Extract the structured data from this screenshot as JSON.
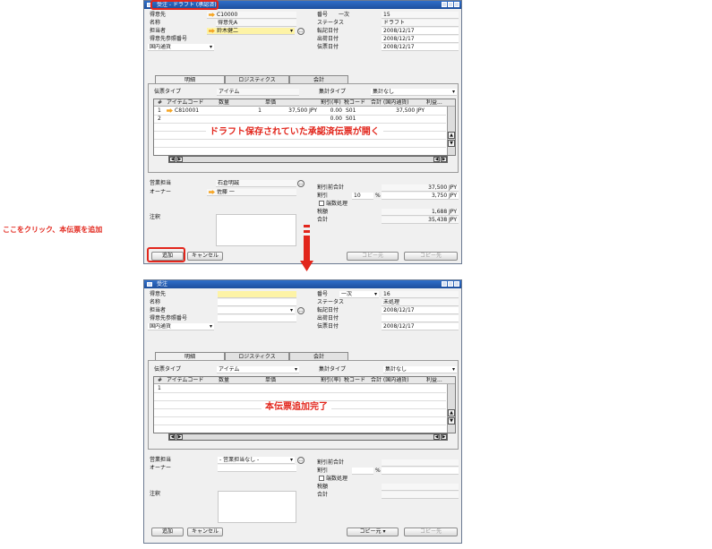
{
  "window1": {
    "title": "受注 - ドラフト (承認済)",
    "header": {
      "customer_label": "得意先",
      "customer_value": "C10000",
      "name_label": "名称",
      "name_value": "得意先A",
      "contact_label": "担当者",
      "contact_value": "鈴木健二",
      "ref_label": "得意先参照番号",
      "currency": "国内通貨",
      "no_label": "番号",
      "no_series": "一次",
      "no_value": "15",
      "status_label": "ステータス",
      "status_value": "ドラフト",
      "posting_label": "転記日付",
      "posting_value": "2008/12/17",
      "delivery_label": "出荷日付",
      "delivery_value": "2008/12/17",
      "doc_date_label": "伝票日付",
      "doc_date_value": "2008/12/17"
    },
    "tabs": [
      "明細",
      "ロジスティクス",
      "会計"
    ],
    "item_type_label": "伝票タイプ",
    "item_type_value": "アイテム",
    "summary_type_label": "集計タイプ",
    "summary_type_value": "集計なし",
    "grid_headers": [
      "#",
      "アイテムコード",
      "数量",
      "単価",
      "割引(率)",
      "税コード",
      "合計 (国内通貨)",
      "利益..."
    ],
    "rows": [
      {
        "no": "1",
        "code": "C810001",
        "qty": "1",
        "price": "37,500 JPY",
        "disc": "0.00",
        "tax": "S01",
        "total": "37,500 JPY"
      },
      {
        "no": "2",
        "code": "",
        "qty": "",
        "price": "",
        "disc": "0.00",
        "tax": "S01",
        "total": ""
      }
    ],
    "footer": {
      "sales_emp_label": "営業担当",
      "sales_emp_value": "石倉明誠",
      "owner_label": "オーナー",
      "owner_value": "佐藤 一",
      "remarks_label": "注釈",
      "before_disc_label": "割引前合計",
      "before_disc_value": "37,500 JPY",
      "disc_label": "割引",
      "disc_pct": "10",
      "disc_pct_sign": "%",
      "disc_value": "3,750 JPY",
      "rounding_label": "端数処理",
      "tax_label": "税額",
      "tax_value": "1,688 JPY",
      "total_label": "合計",
      "total_value": "35,438 JPY"
    },
    "buttons": {
      "add": "追加",
      "cancel": "キャンセル",
      "copy_from": "コピー元",
      "copy_to": "コピー先"
    },
    "annotation": "ドラフト保存されていた承認済伝票が開く"
  },
  "side_annotation": "ここをクリック、本伝票を追加",
  "window2": {
    "title": "受注",
    "header": {
      "customer_label": "得意先",
      "name_label": "名称",
      "contact_label": "担当者",
      "ref_label": "得意先参照番号",
      "currency": "国内通貨",
      "no_label": "番号",
      "no_series": "一次",
      "no_value": "16",
      "status_label": "ステータス",
      "status_value": "未処理",
      "posting_label": "転記日付",
      "posting_value": "2008/12/17",
      "delivery_label": "出荷日付",
      "delivery_value": "",
      "doc_date_label": "伝票日付",
      "doc_date_value": "2008/12/17"
    },
    "tabs": [
      "明細",
      "ロジスティクス",
      "会計"
    ],
    "item_type_label": "伝票タイプ",
    "item_type_value": "アイテム",
    "summary_type_label": "集計タイプ",
    "summary_type_value": "集計なし",
    "grid_headers": [
      "#",
      "アイテムコード",
      "数量",
      "単価",
      "割引(率)",
      "税コード",
      "合計 (国内通貨)",
      "利益..."
    ],
    "rows": [
      {
        "no": "1"
      }
    ],
    "footer": {
      "sales_emp_label": "営業担当",
      "sales_emp_value": "- 営業担当なし -",
      "owner_label": "オーナー",
      "remarks_label": "注釈",
      "before_disc_label": "割引前合計",
      "disc_label": "割引",
      "disc_pct_sign": "%",
      "rounding_label": "端数処理",
      "tax_label": "税額",
      "total_label": "合計"
    },
    "buttons": {
      "add": "追加",
      "cancel": "キャンセル",
      "copy_from": "コピー元",
      "copy_to": "コピー先"
    },
    "annotation": "本伝票追加完了"
  },
  "colors": {
    "annotation_red": "#e2261c",
    "title_blue": "#1d4f9e",
    "field_yellow": "#fdf3a6"
  }
}
